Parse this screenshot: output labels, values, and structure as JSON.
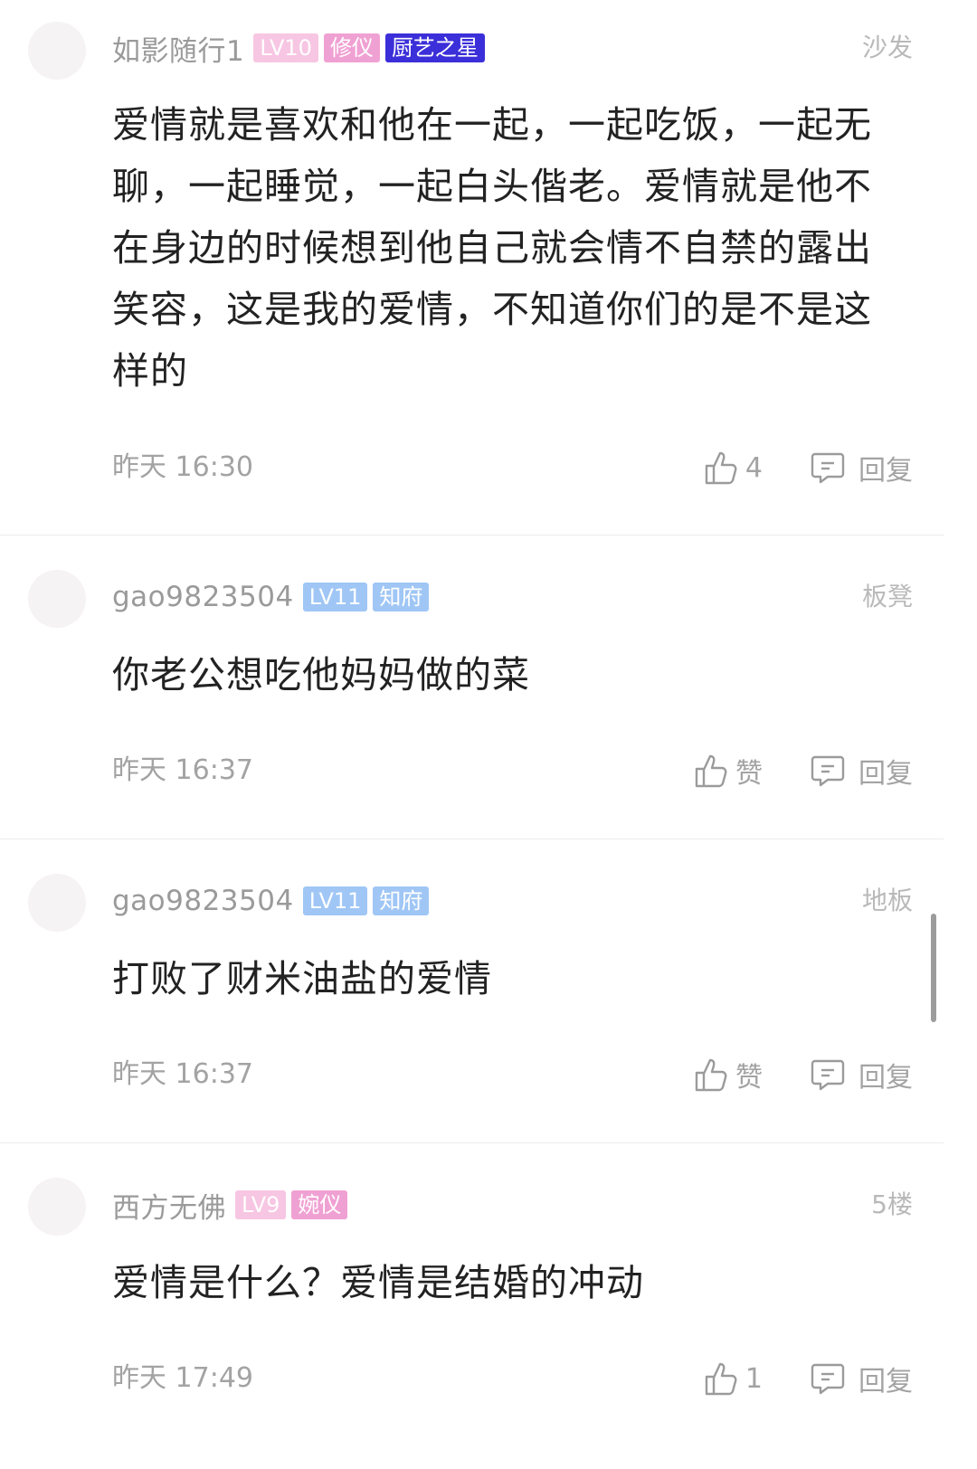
{
  "comments": [
    {
      "username": "如影随行1",
      "badges": [
        {
          "text": "LV10",
          "color": "#f7c6e3"
        },
        {
          "text": "修仪",
          "color": "#f0a1d3"
        },
        {
          "text": "厨艺之星",
          "color": "#3b2fd9"
        }
      ],
      "floor": "沙发",
      "text": "爱情就是喜欢和他在一起，一起吃饭，一起无聊，一起睡觉，一起白头偕老。爱情就是他不在身边的时候想到他自己就会情不自禁的露出笑容，这是我的爱情，不知道你们的是不是这样的",
      "time": "昨天 16:30",
      "like_label": "4",
      "reply_label": "回复"
    },
    {
      "username": "gao9823504",
      "badges": [
        {
          "text": "LV11",
          "color": "#9fc6f5"
        },
        {
          "text": "知府",
          "color": "#9fc6f5"
        }
      ],
      "floor": "板凳",
      "text": "你老公想吃他妈妈做的菜",
      "time": "昨天 16:37",
      "like_label": "赞",
      "reply_label": "回复"
    },
    {
      "username": "gao9823504",
      "badges": [
        {
          "text": "LV11",
          "color": "#9fc6f5"
        },
        {
          "text": "知府",
          "color": "#9fc6f5"
        }
      ],
      "floor": "地板",
      "text": "打败了财米油盐的爱情",
      "time": "昨天 16:37",
      "like_label": "赞",
      "reply_label": "回复"
    },
    {
      "username": "西方无佛",
      "badges": [
        {
          "text": "LV9",
          "color": "#f7c6e3"
        },
        {
          "text": "婉仪",
          "color": "#f0a1d3"
        }
      ],
      "floor": "5楼",
      "text": "爱情是什么？爱情是结婚的冲动",
      "time": "昨天 17:49",
      "like_label": "1",
      "reply_label": "回复"
    }
  ],
  "icons": {
    "like": "thumbs-up-icon",
    "reply": "comment-bubble-icon"
  }
}
